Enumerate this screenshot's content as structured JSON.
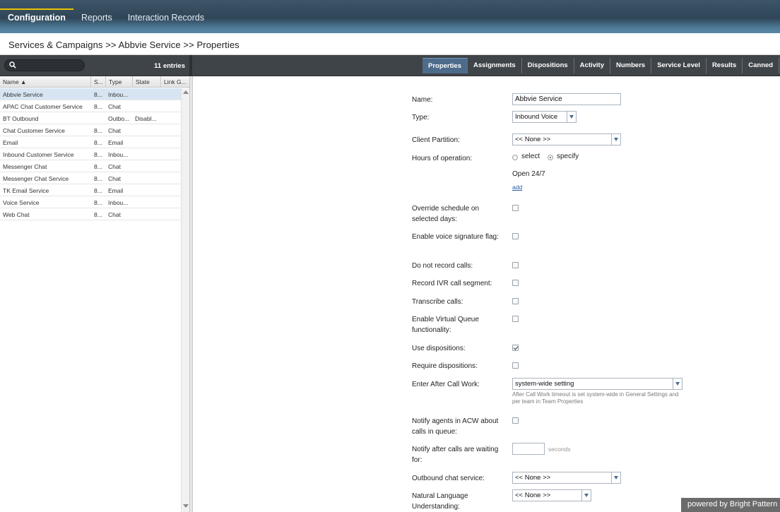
{
  "topnav": {
    "tabs": [
      {
        "label": "Configuration",
        "active": true
      },
      {
        "label": "Reports",
        "active": false
      },
      {
        "label": "Interaction Records",
        "active": false
      }
    ]
  },
  "breadcrumb": "Services & Campaigns >> Abbvie Service >> Properties",
  "list": {
    "search_value": "",
    "entries": "11 entries",
    "columns": [
      "Name ▲",
      "S...",
      "Type",
      "State",
      "Link G..."
    ],
    "rows": [
      {
        "name": "Abbvie Service",
        "s": "8...",
        "type": "Inbou...",
        "state": "",
        "selected": true
      },
      {
        "name": "APAC Chat Customer Service",
        "s": "8...",
        "type": "Chat",
        "state": ""
      },
      {
        "name": "BT Outbound",
        "s": "",
        "type": "Outbo...",
        "state": "Disabl..."
      },
      {
        "name": "Chat Customer Service",
        "s": "8...",
        "type": "Chat",
        "state": ""
      },
      {
        "name": "Email",
        "s": "8...",
        "type": "Email",
        "state": ""
      },
      {
        "name": "Inbound Customer Service",
        "s": "8...",
        "type": "Inbou...",
        "state": ""
      },
      {
        "name": "Messenger Chat",
        "s": "8...",
        "type": "Chat",
        "state": ""
      },
      {
        "name": "Messenger Chat Service",
        "s": "8...",
        "type": "Chat",
        "state": ""
      },
      {
        "name": "TK Email Service",
        "s": "8...",
        "type": "Email",
        "state": ""
      },
      {
        "name": "Voice Service",
        "s": "8...",
        "type": "Inbou...",
        "state": ""
      },
      {
        "name": "Web Chat",
        "s": "8...",
        "type": "Chat",
        "state": ""
      }
    ]
  },
  "tabs": [
    "Properties",
    "Assignments",
    "Dispositions",
    "Activity",
    "Numbers",
    "Service Level",
    "Results",
    "Canned"
  ],
  "form": {
    "name_label": "Name:",
    "name_value": "Abbvie Service",
    "type_label": "Type:",
    "type_value": "Inbound Voice",
    "partition_label": "Client Partition:",
    "partition_value": "<< None >>",
    "hours_label": "Hours of operation:",
    "hours_select": "select",
    "hours_specify": "specify",
    "open_text": "Open 24/7",
    "add_link": "add",
    "override_label": "Override schedule on selected days:",
    "voice_sig_label": "Enable voice signature flag:",
    "no_record_label": "Do not record calls:",
    "ivr_label": "Record IVR call segment:",
    "transcribe_label": "Transcribe calls:",
    "vq_label": "Enable Virtual Queue functionality:",
    "use_disp_label": "Use dispositions:",
    "req_disp_label": "Require dispositions:",
    "acw_label": "Enter After Call Work:",
    "acw_value": "system-wide setting",
    "acw_hint": "After Call Work timeout is set system-wide in General Settings and per team in Team Properties",
    "notify_acw_label": "Notify agents in ACW about calls in queue:",
    "notify_after_label": "Notify after calls are waiting for:",
    "notify_after_value": "",
    "seconds": "seconds",
    "outbound_chat_label": "Outbound chat service:",
    "outbound_chat_value": "<< None >>",
    "nlu_label": "Natural Language Understanding:",
    "nlu_value": "<< None >>"
  },
  "footer": "powered by Bright Pattern"
}
